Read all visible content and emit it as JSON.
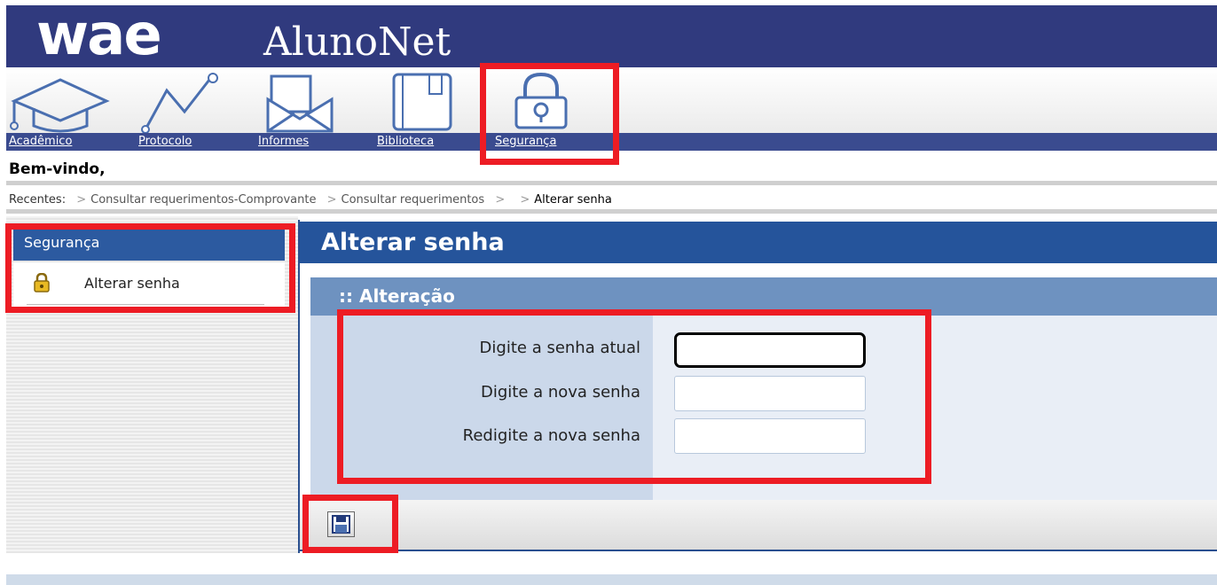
{
  "header": {
    "logo_text": "wae",
    "app_name": "AlunoNet"
  },
  "nav": {
    "items": [
      {
        "label": "Acadêmico",
        "icon": "graduation-cap-icon"
      },
      {
        "label": "Protocolo",
        "icon": "line-graph-icon"
      },
      {
        "label": "Informes",
        "icon": "envelope-icon"
      },
      {
        "label": "Biblioteca",
        "icon": "book-icon"
      },
      {
        "label": "Segurança",
        "icon": "padlock-icon"
      }
    ]
  },
  "welcome": {
    "text": "Bem-vindo,"
  },
  "breadcrumb": {
    "label": "Recentes:",
    "items": [
      "Consultar requerimentos-Comprovante",
      "Consultar requerimentos",
      "",
      "Alterar senha"
    ],
    "separator": ">"
  },
  "sidebar": {
    "title": "Segurança",
    "items": [
      {
        "label": "Alterar senha",
        "icon": "lock-icon"
      }
    ]
  },
  "main": {
    "title": "Alterar senha",
    "section_title": ":: Alteração",
    "fields": [
      {
        "label": "Digite a senha atual",
        "value": "",
        "focused": true
      },
      {
        "label": "Digite a nova senha",
        "value": ""
      },
      {
        "label": "Redigite a nova senha",
        "value": ""
      }
    ],
    "save_icon": "floppy-disk-icon"
  },
  "colors": {
    "header_bg": "#303a7e",
    "title_bar": "#25549b",
    "section_bar": "#6e92c0",
    "highlight": "#ed1c24"
  }
}
